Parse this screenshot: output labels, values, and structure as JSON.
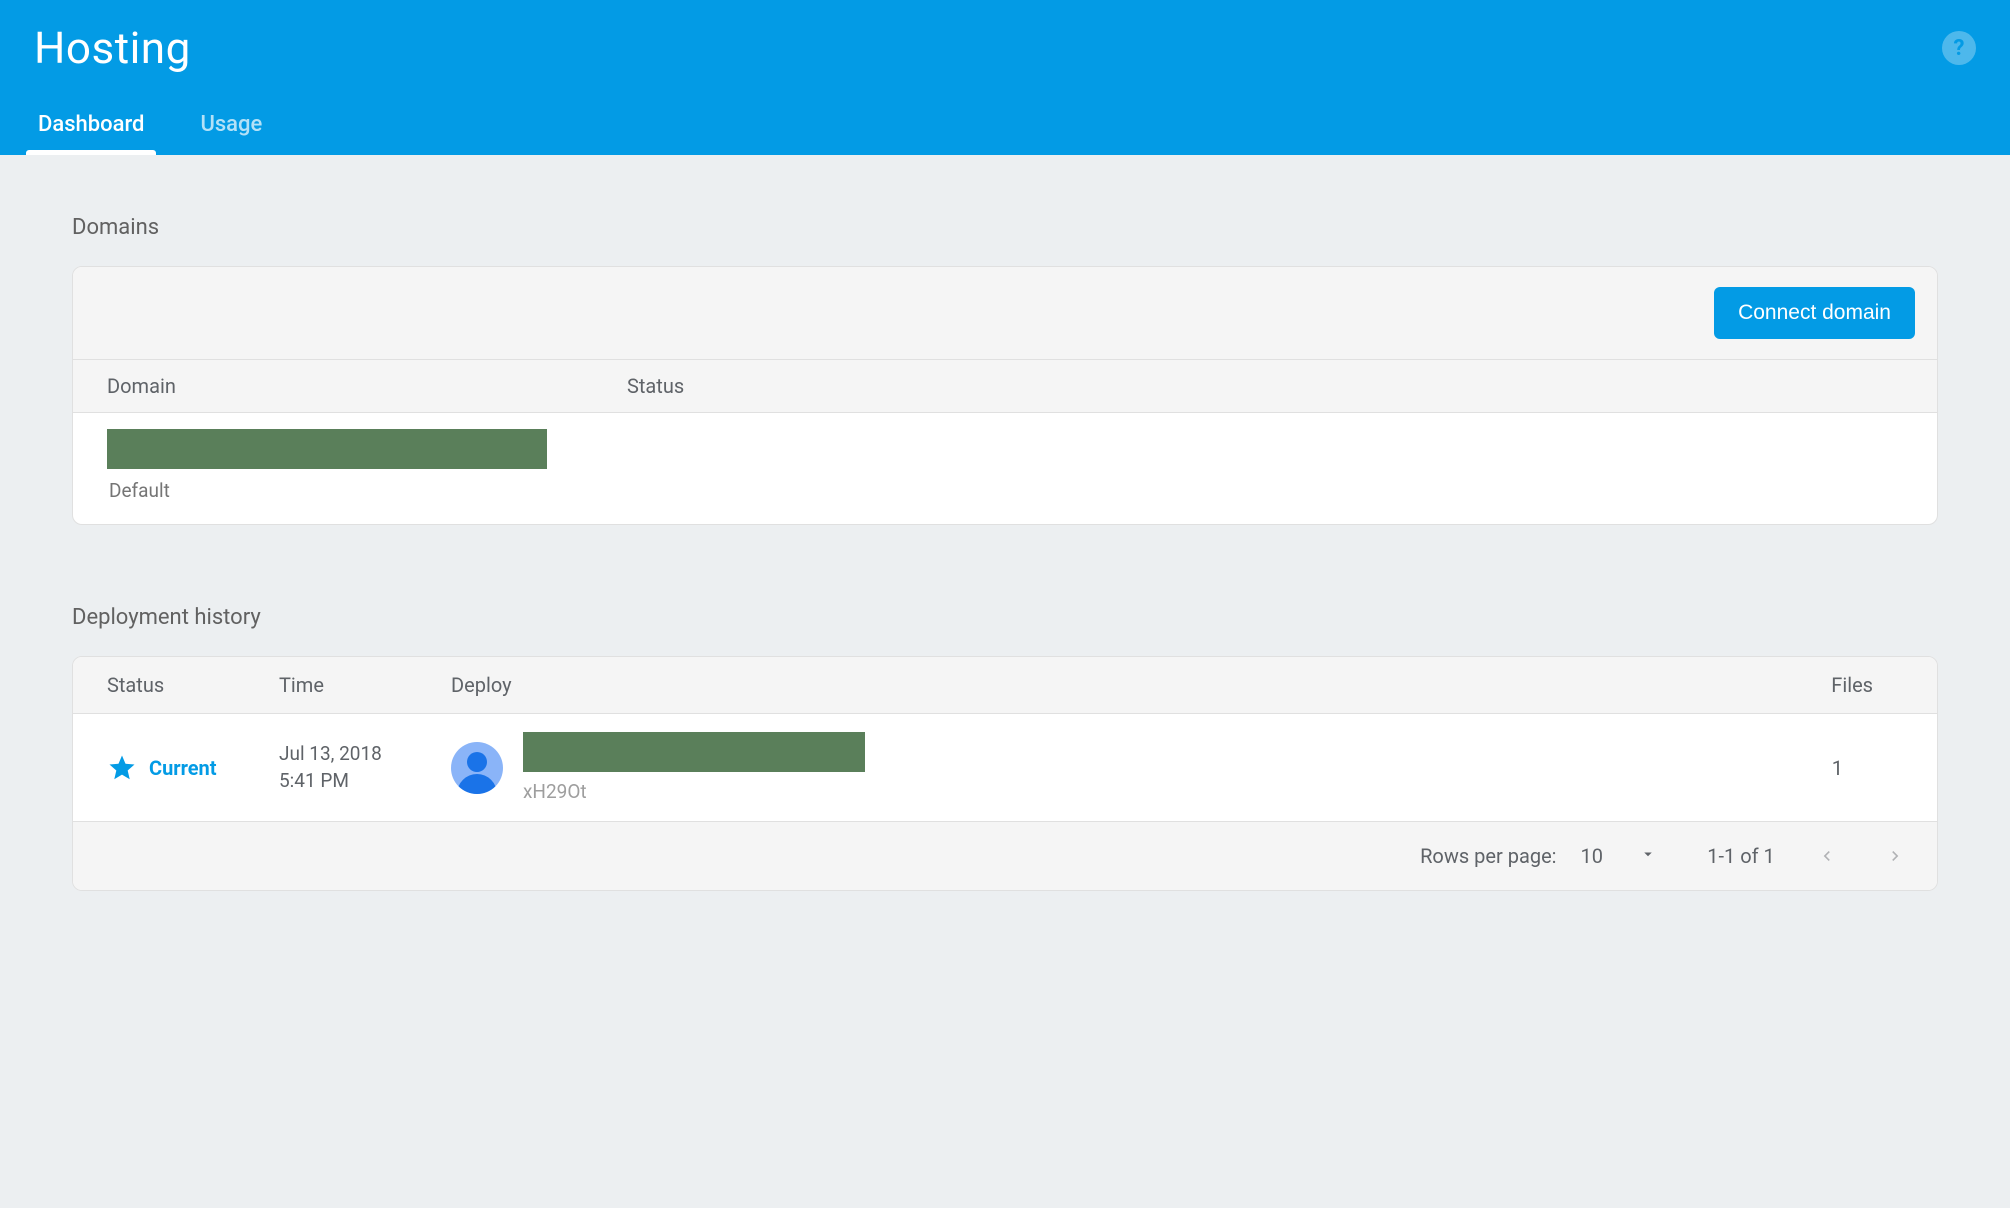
{
  "header": {
    "title": "Hosting",
    "tabs": [
      {
        "label": "Dashboard",
        "active": true
      },
      {
        "label": "Usage",
        "active": false
      }
    ]
  },
  "domains_section": {
    "title": "Domains",
    "connect_button": "Connect domain",
    "columns": {
      "domain": "Domain",
      "status": "Status"
    },
    "rows": [
      {
        "name_redacted": true,
        "sublabel": "Default",
        "status": ""
      }
    ]
  },
  "deploy_section": {
    "title": "Deployment history",
    "columns": {
      "status": "Status",
      "time": "Time",
      "deploy": "Deploy",
      "files": "Files"
    },
    "rows": [
      {
        "status_label": "Current",
        "date": "Jul 13, 2018",
        "time": "5:41 PM",
        "deployer_redacted": true,
        "deploy_id": "xH29Ot",
        "files": "1"
      }
    ],
    "pagination": {
      "rows_label": "Rows per page:",
      "page_size": "10",
      "range": "1-1 of 1"
    }
  }
}
